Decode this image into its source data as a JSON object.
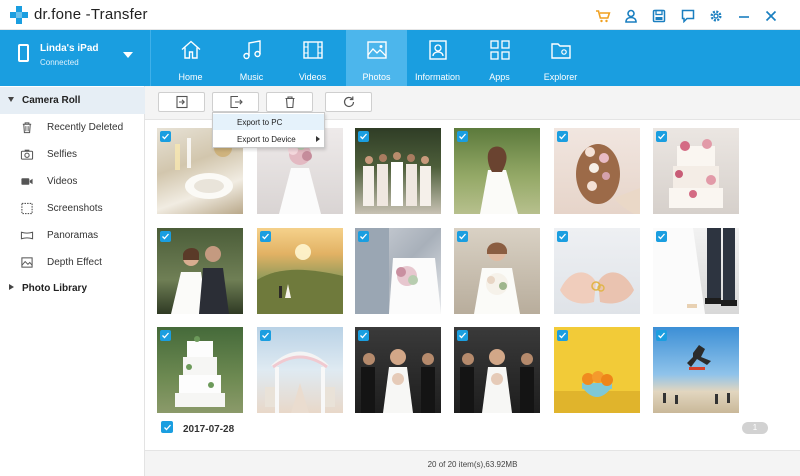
{
  "app": {
    "title": "dr.fone -Transfer",
    "brand_color": "#1a9ee0",
    "accent_color": "#f0a020"
  },
  "title_icons": [
    "cart-icon",
    "user-icon",
    "save-icon",
    "feedback-icon",
    "settings-icon",
    "minimize-icon",
    "close-icon"
  ],
  "device": {
    "name": "Linda's iPad",
    "status": "Connected"
  },
  "tabs": [
    {
      "label": "Home",
      "icon": "home-icon",
      "active": false
    },
    {
      "label": "Music",
      "icon": "music-icon",
      "active": false
    },
    {
      "label": "Videos",
      "icon": "videos-icon",
      "active": false
    },
    {
      "label": "Photos",
      "icon": "photos-icon",
      "active": true
    },
    {
      "label": "Information",
      "icon": "information-icon",
      "active": false
    },
    {
      "label": "Apps",
      "icon": "apps-icon",
      "active": false
    },
    {
      "label": "Explorer",
      "icon": "explorer-icon",
      "active": false
    }
  ],
  "sidebar": {
    "camera_roll": "Camera Roll",
    "items": [
      {
        "label": "Recently Deleted",
        "icon": "trash-icon"
      },
      {
        "label": "Selfies",
        "icon": "camera-icon"
      },
      {
        "label": "Videos",
        "icon": "video-camera-icon"
      },
      {
        "label": "Screenshots",
        "icon": "screenshot-icon"
      },
      {
        "label": "Panoramas",
        "icon": "panorama-icon"
      },
      {
        "label": "Depth Effect",
        "icon": "depth-effect-icon"
      }
    ],
    "photo_library": "Photo Library"
  },
  "toolbar": {
    "buttons": [
      "import-icon",
      "export-icon",
      "delete-icon",
      "refresh-icon"
    ]
  },
  "export_menu": {
    "items": [
      "Export to PC",
      "Export to Device"
    ],
    "highlighted": "Export to PC"
  },
  "photos": [
    {
      "subject": "wedding table setting",
      "checked": true
    },
    {
      "subject": "bride with bouquet",
      "checked": true
    },
    {
      "subject": "bridesmaids group",
      "checked": true
    },
    {
      "subject": "bride in garden",
      "checked": true
    },
    {
      "subject": "bride hair flowers",
      "checked": true
    },
    {
      "subject": "wedding cake",
      "checked": true
    },
    {
      "subject": "couple portrait",
      "checked": true
    },
    {
      "subject": "couple on hill at sunset",
      "checked": true
    },
    {
      "subject": "couple holding bouquet",
      "checked": true
    },
    {
      "subject": "bride with bouquet",
      "checked": true
    },
    {
      "subject": "hands with rings",
      "checked": true
    },
    {
      "subject": "bride and groom feet",
      "checked": true
    },
    {
      "subject": "white wedding cake",
      "checked": true
    },
    {
      "subject": "wedding arch",
      "checked": true
    },
    {
      "subject": "bride with bridesmaids",
      "checked": true
    },
    {
      "subject": "bride with bridesmaids",
      "checked": true
    },
    {
      "subject": "bowl of oranges",
      "checked": true
    },
    {
      "subject": "skateboarder on beach",
      "checked": true
    }
  ],
  "date_group": "2017-07-28",
  "page_number": "1",
  "status": "20 of 20 item(s),63.92MB"
}
